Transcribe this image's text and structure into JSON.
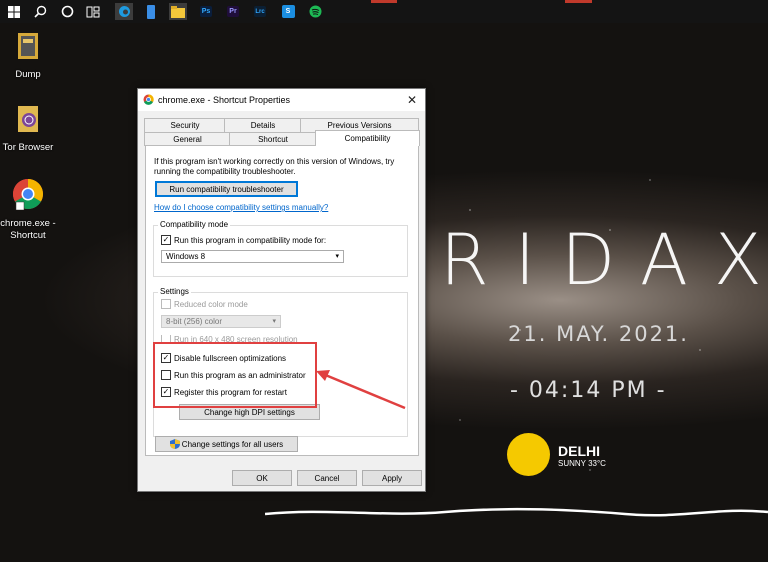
{
  "taskbar": {
    "icons": [
      "windows-start-icon",
      "search-icon",
      "cortana-icon",
      "task-view-icon",
      "edge-icon",
      "phone-icon",
      "file-explorer-icon",
      "photoshop-icon",
      "premiere-icon",
      "lightroom-icon",
      "s-app-icon",
      "spotify-icon"
    ],
    "ps": "Ps",
    "pr": "Pr",
    "lrc": "Lrc",
    "s": "S"
  },
  "desktop": {
    "items": [
      {
        "label": "Dump"
      },
      {
        "label": "Tor Browser"
      },
      {
        "label": "chrome.exe - Shortcut"
      }
    ]
  },
  "widget": {
    "title": "RIDAX",
    "date": "21. MAY. 2021.",
    "time": "- 04:14 PM -",
    "city": "DELHI",
    "weather": "SUNNY 33°C",
    "sun_color": "#f5c900"
  },
  "dialog": {
    "title": "chrome.exe - Shortcut Properties",
    "tabs_row1": [
      "Security",
      "Details",
      "Previous Versions"
    ],
    "tabs_row2": [
      "General",
      "Shortcut",
      "Compatibility"
    ],
    "selected_tab": "Compatibility",
    "intro": "If this program isn't working correctly on this version of Windows, try running the compatibility troubleshooter.",
    "troubleshooter_btn": "Run compatibility troubleshooter",
    "manual_link": "How do I choose compatibility settings manually?",
    "compat_group": "Compatibility mode",
    "compat_check": "Run this program in compatibility mode for:",
    "compat_value": "Windows 8",
    "settings_group": "Settings",
    "reduced_color": "Reduced color mode",
    "color_value": "8-bit (256) color",
    "run_640": "Run in 640 x 480 screen resolution",
    "disable_fullscreen": "Disable fullscreen optimizations",
    "run_admin": "Run this program as an administrator",
    "register_restart": "Register this program for restart",
    "dpi_btn": "Change high DPI settings",
    "all_users_btn": "Change settings for all users",
    "ok": "OK",
    "cancel": "Cancel",
    "apply": "Apply"
  }
}
